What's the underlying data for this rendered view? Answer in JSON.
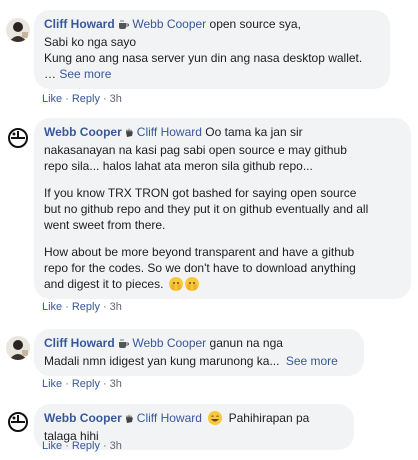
{
  "comments": [
    {
      "author": "Cliff Howard",
      "mention": "Webb Cooper",
      "lines": [
        "open source sya,",
        "Sabi ko nga sayo",
        "Kung ano ang nasa server yun din ang nasa desktop wallet."
      ],
      "ellipsis": "…",
      "see_more": "See more",
      "actions": {
        "like": "Like",
        "reply": "Reply",
        "time": "3h"
      }
    },
    {
      "author": "Webb Cooper",
      "mention": "Cliff Howard",
      "paragraphs": [
        [
          "Oo tama ka jan sir",
          "nakasanayan na kasi pag sabi open source e may github",
          "repo sila... halos lahat ata meron sila github repo..."
        ],
        [
          "If you know TRX TRON got bashed for saying open source",
          "but no github repo and they put it on github eventually and all",
          "went sweet from there."
        ],
        [
          "How about be more beyond transparent and have a github",
          "repo for the codes. So we don't have to download anything",
          "and digest it to pieces."
        ]
      ],
      "actions": {
        "like": "Like",
        "reply": "Reply",
        "time": "3h"
      }
    },
    {
      "author": "Cliff Howard",
      "mention": "Webb Cooper",
      "lines": [
        "ganun na nga",
        "Madali nmn idigest yan kung marunong ka..."
      ],
      "see_more": "See more",
      "actions": {
        "like": "Like",
        "reply": "Reply",
        "time": "3h"
      }
    },
    {
      "author": "Webb Cooper",
      "mention": "Cliff Howard",
      "lines": [
        "Pahihirapan pa talaga hihi"
      ],
      "actions": {
        "like": "Like",
        "reply": "Reply",
        "time": "3h"
      }
    }
  ],
  "separator": "·",
  "colors": {
    "link": "#385898",
    "bubble": "#f2f3f5",
    "meta": "#606770"
  },
  "icons": {
    "coffee": "coffee-icon",
    "wave": "hand-wave-icon",
    "peek": "peeking-face-emoji",
    "grin": "grinning-face-emoji"
  }
}
